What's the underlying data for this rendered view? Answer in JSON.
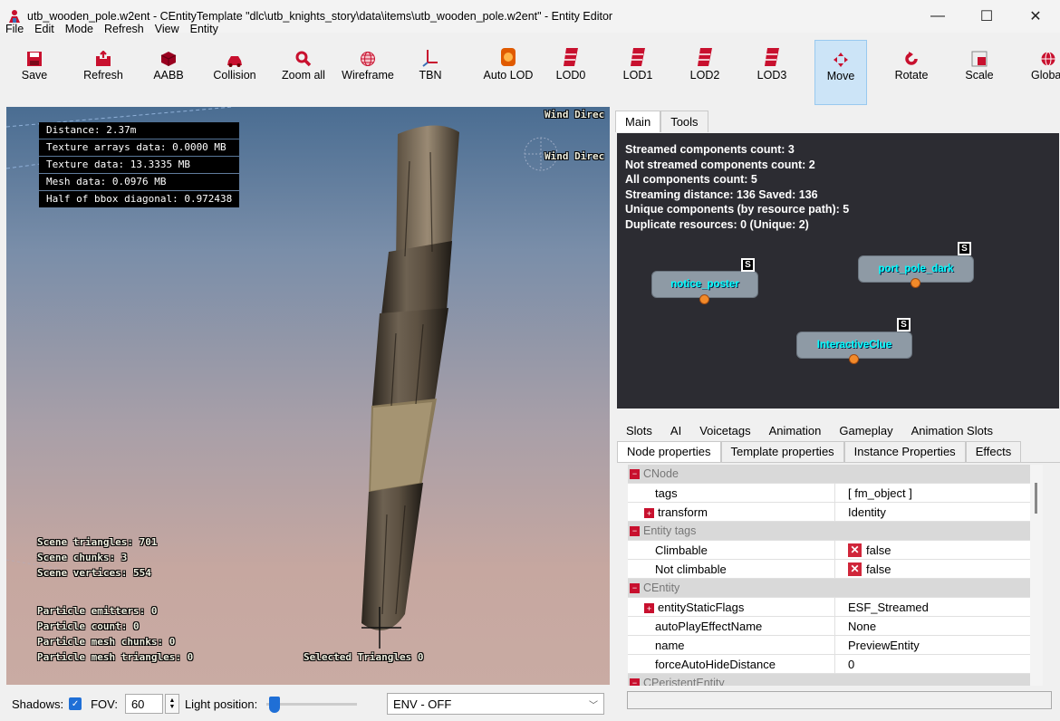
{
  "window": {
    "title": "utb_wooden_pole.w2ent - CEntityTemplate \"dlc\\utb_knights_story\\data\\items\\utb_wooden_pole.w2ent\" - Entity Editor",
    "minimize": "—",
    "maximize": "☐",
    "close": "✕"
  },
  "menu": [
    "File",
    "Edit",
    "Mode",
    "Refresh",
    "View",
    "Entity"
  ],
  "toolbar": [
    {
      "label": "Save",
      "icon": "save-icon",
      "color": "#c8102e"
    },
    {
      "label": "Refresh",
      "icon": "refresh-icon",
      "color": "#c8102e"
    },
    {
      "label": "AABB",
      "icon": "aabb-icon",
      "color": "#a00020"
    },
    {
      "label": "Collision",
      "icon": "collision-icon",
      "color": "#c8102e"
    },
    {
      "label": "Zoom all",
      "icon": "zoom-icon",
      "color": "#c8102e"
    },
    {
      "label": "Wireframe",
      "icon": "wireframe-icon",
      "color": "#c8102e"
    },
    {
      "label": "TBN",
      "icon": "tbn-icon",
      "color": "#c8102e"
    },
    {
      "label": "Auto LOD",
      "icon": "auto-lod-icon",
      "color": "#e05a00"
    },
    {
      "label": "LOD0",
      "icon": "lod-icon",
      "color": "#c8102e"
    },
    {
      "label": "LOD1",
      "icon": "lod-icon",
      "color": "#c8102e"
    },
    {
      "label": "LOD2",
      "icon": "lod-icon",
      "color": "#c8102e"
    },
    {
      "label": "LOD3",
      "icon": "lod-icon",
      "color": "#c8102e"
    },
    {
      "label": "Move",
      "icon": "move-icon",
      "color": "#c8102e"
    },
    {
      "label": "Rotate",
      "icon": "rotate-icon",
      "color": "#c8102e"
    },
    {
      "label": "Scale",
      "icon": "scale-icon",
      "color": "#c8102e"
    },
    {
      "label": "Global",
      "icon": "global-icon",
      "color": "#c8102e"
    }
  ],
  "viewport": {
    "stats": [
      "Distance: 2.37m",
      "Texture arrays data: 0.0000 MB",
      "Texture data: 13.3335 MB",
      "Mesh data: 0.0976 MB",
      "Half of bbox diagonal: 0.972438"
    ],
    "wind_label": "Wind Direc",
    "wind_label_2": "Wind Direc",
    "scene": [
      "Scene triangles: 701",
      "Scene chunks: 3",
      "Scene vertices: 554"
    ],
    "particles": [
      "Particle emitters: 0",
      "Particle count: 0",
      "Particle mesh chunks: 0",
      "Particle mesh triangles: 0"
    ],
    "selected_triangles": "Selected Triangles 0"
  },
  "bottom": {
    "shadows_label": "Shadows:",
    "fov_label": "FOV:",
    "fov_value": "60",
    "light_label": "Light position:",
    "light_position": 0.03,
    "env_value": "ENV - OFF"
  },
  "right_tabs": [
    "Main",
    "Tools"
  ],
  "graph": {
    "info": [
      "Streamed components count: 3",
      "Not streamed components count: 2",
      "All components count: 5",
      "Streaming distance: 136 Saved: 136",
      "Unique components (by resource path): 5",
      "Duplicate resources: 0 (Unique: 2)"
    ],
    "nodes": [
      {
        "label": "notice_poster",
        "badge": "S"
      },
      {
        "label": "port_pole_dark",
        "badge": "S"
      },
      {
        "label": "InteractiveClue",
        "badge": "S"
      }
    ]
  },
  "prop_tabs_row1": [
    "Slots",
    "AI",
    "Voicetags",
    "Animation",
    "Gameplay",
    "Animation Slots"
  ],
  "prop_tabs_row2": [
    "Node properties",
    "Template properties",
    "Instance Properties",
    "Effects"
  ],
  "properties": {
    "groups": {
      "cnode": "CNode",
      "entity_tags": "Entity tags",
      "centity": "CEntity",
      "cpersistent": "CPeristentEntity"
    },
    "rows": {
      "tags": {
        "name": "tags",
        "value": "[ fm_object ]"
      },
      "transform": {
        "name": "transform",
        "value": "Identity"
      },
      "climbable": {
        "name": "Climbable",
        "value": "false"
      },
      "not_climbable": {
        "name": "Not climbable",
        "value": "false"
      },
      "static_flags": {
        "name": "entityStaticFlags",
        "value": "ESF_Streamed"
      },
      "autoplay": {
        "name": "autoPlayEffectName",
        "value": "None"
      },
      "name": {
        "name": "name",
        "value": "PreviewEntity"
      },
      "autohide": {
        "name": "forceAutoHideDistance",
        "value": "0"
      }
    }
  }
}
